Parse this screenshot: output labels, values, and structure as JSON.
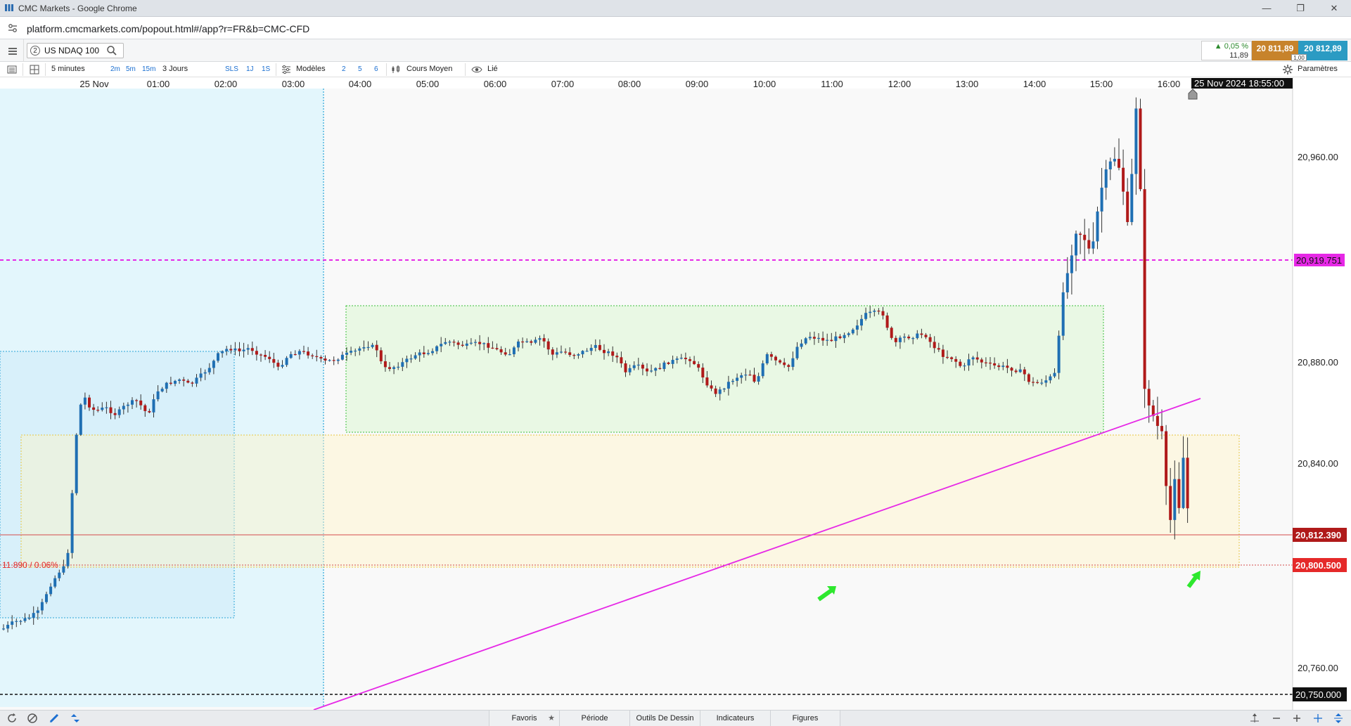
{
  "window": {
    "title": "CMC Markets - Google Chrome",
    "url": "platform.cmcmarkets.com/popout.html#/app?r=FR&b=CMC-CFD"
  },
  "instrument": {
    "slot": "2",
    "name": "US NDAQ 100",
    "change_pct": "▲ 0,05 %",
    "change_abs": "11,89",
    "sell_price": "20 811,89",
    "buy_price": "20 812,89",
    "spread": "1,00"
  },
  "toolbar": {
    "interval": "5 minutes",
    "quick_intervals": [
      "2m",
      "5m",
      "15m"
    ],
    "period": "3 Jours",
    "sls": "SLS",
    "period_buttons": [
      "1J",
      "1S"
    ],
    "templates": "Modèles",
    "template_slots": [
      "2",
      "5",
      "6"
    ],
    "price_type": "Cours Moyen",
    "linked": "Lié",
    "settings": "Paramètres"
  },
  "chart": {
    "time_labels": [
      "25 Nov",
      "01:00",
      "02:00",
      "03:00",
      "04:00",
      "05:00",
      "06:00",
      "07:00",
      "08:00",
      "09:00",
      "10:00",
      "11:00",
      "12:00",
      "13:00",
      "14:00",
      "15:00",
      "16:00"
    ],
    "cursor_time": "25 Nov 2024 18:55:00",
    "price_labels": [
      "20,960.00",
      "20,880.00",
      "20,840.00",
      "20,760.00"
    ],
    "level_magenta": "20,919.751",
    "level_current": "20,812.390",
    "level_red": "20,800.500",
    "level_black": "20,750.000",
    "change_annotation": "11.890 / 0.06%",
    "colors": {
      "up": "#1f6fb3",
      "down": "#b01a1a",
      "magenta": "#e628e6",
      "current_line": "#d44b4b",
      "arrow": "#2ee82e"
    }
  },
  "bottombar": {
    "tabs": [
      "Favoris",
      "Période",
      "Outils De Dessin",
      "Indicateurs",
      "Figures"
    ]
  }
}
